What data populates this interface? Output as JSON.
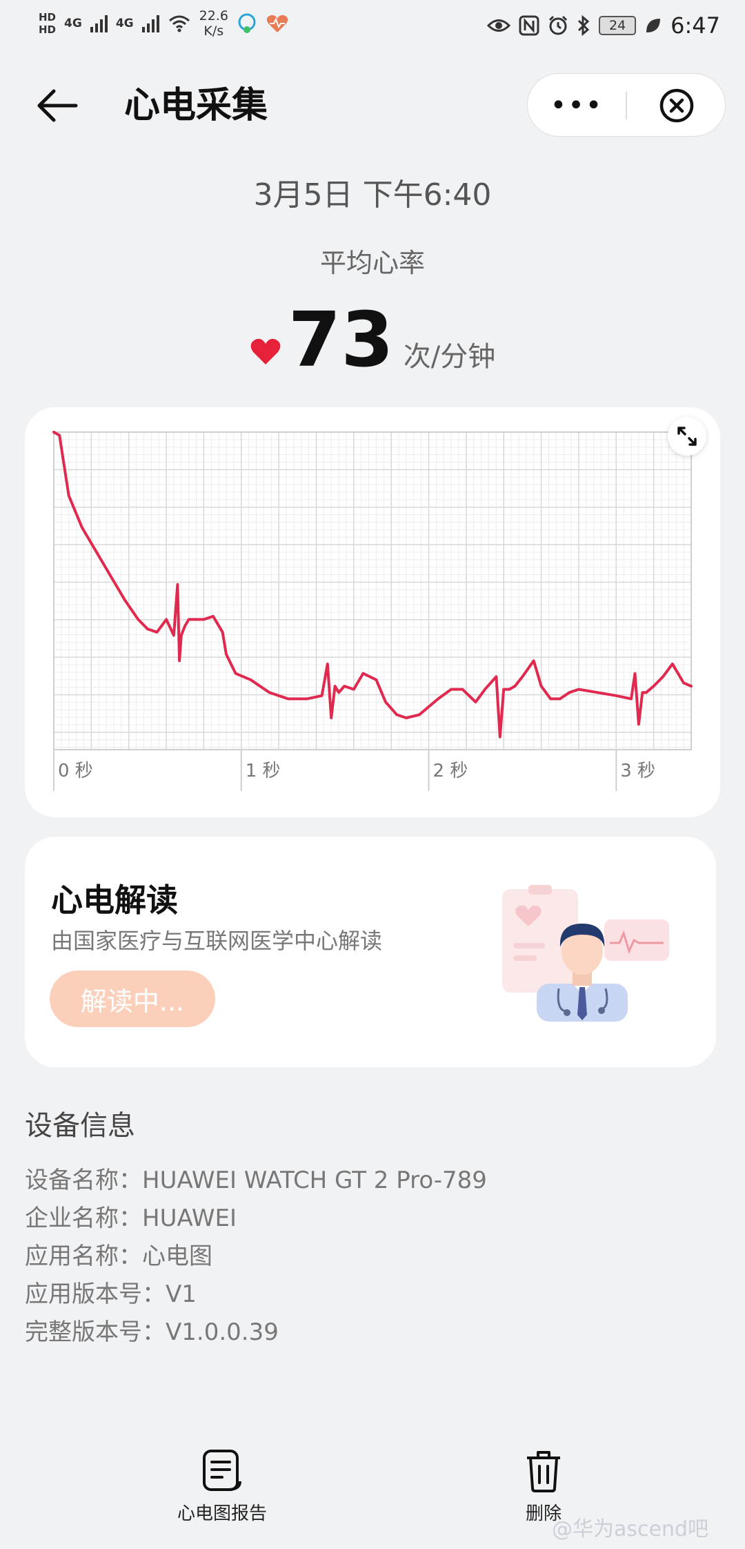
{
  "status_bar": {
    "hd1": "HD",
    "hd2": "HD",
    "net1": "4G",
    "net2": "4G",
    "speed_value": "22.6",
    "speed_unit": "K/s",
    "battery": "24",
    "time": "6:47"
  },
  "header": {
    "title": "心电采集",
    "more_label": "•••"
  },
  "summary": {
    "datetime": "3月5日 下午6:40",
    "avg_label": "平均心率",
    "heart_rate": "73",
    "unit": "次/分钟"
  },
  "chart_data": {
    "type": "line",
    "title": "",
    "xlabel": "",
    "ylabel": "",
    "x_tick_labels": [
      "0 秒",
      "1 秒",
      "2 秒",
      "3 秒"
    ],
    "xlim": [
      0,
      3.4
    ],
    "grid": true,
    "color": "#e0294f",
    "series": [
      {
        "x": [
          0,
          0.03,
          0.08,
          0.15,
          0.22,
          0.3,
          0.38,
          0.45,
          0.5,
          0.55,
          0.6,
          0.64,
          0.66,
          0.67,
          0.68,
          0.7,
          0.72,
          0.75,
          0.8,
          0.85,
          0.9,
          0.92,
          0.97,
          1.05,
          1.15,
          1.25,
          1.35,
          1.43,
          1.46,
          1.48,
          1.5,
          1.52,
          1.55,
          1.6,
          1.65,
          1.72,
          1.77,
          1.83,
          1.88,
          1.95,
          2.05,
          2.12,
          2.18,
          2.25,
          2.3,
          2.36,
          2.38,
          2.4,
          2.43,
          2.46,
          2.5,
          2.56,
          2.6,
          2.65,
          2.7,
          2.75,
          2.8,
          2.9,
          3.0,
          3.08,
          3.1,
          3.12,
          3.14,
          3.16,
          3.2,
          3.25,
          3.3,
          3.36,
          3.4
        ],
        "y": [
          1.0,
          0.99,
          0.8,
          0.7,
          0.63,
          0.55,
          0.47,
          0.41,
          0.38,
          0.37,
          0.41,
          0.36,
          0.52,
          0.28,
          0.36,
          0.39,
          0.41,
          0.41,
          0.41,
          0.42,
          0.37,
          0.3,
          0.24,
          0.22,
          0.18,
          0.16,
          0.16,
          0.17,
          0.27,
          0.1,
          0.2,
          0.18,
          0.2,
          0.19,
          0.24,
          0.22,
          0.15,
          0.11,
          0.1,
          0.11,
          0.16,
          0.19,
          0.19,
          0.15,
          0.19,
          0.23,
          0.04,
          0.19,
          0.19,
          0.2,
          0.23,
          0.28,
          0.2,
          0.16,
          0.16,
          0.18,
          0.19,
          0.18,
          0.17,
          0.16,
          0.24,
          0.08,
          0.18,
          0.18,
          0.2,
          0.23,
          0.27,
          0.21,
          0.2
        ]
      }
    ]
  },
  "interpretation": {
    "title": "心电解读",
    "subtitle": "由国家医疗与互联网医学中心解读",
    "button": "解读中..."
  },
  "device_info": {
    "title": "设备信息",
    "rows": [
      "设备名称：HUAWEI WATCH GT 2 Pro-789",
      "企业名称：HUAWEI",
      "应用名称：心电图",
      "应用版本号：V1",
      "完整版本号：V1.0.0.39"
    ]
  },
  "bottom_bar": {
    "report": "心电图报告",
    "delete": "删除"
  },
  "watermark": "@华为ascend吧",
  "icons": [
    "back-arrow-icon",
    "close-circle-icon",
    "heart-icon",
    "expand-icon",
    "doctor-illustration",
    "report-icon",
    "trash-icon"
  ]
}
